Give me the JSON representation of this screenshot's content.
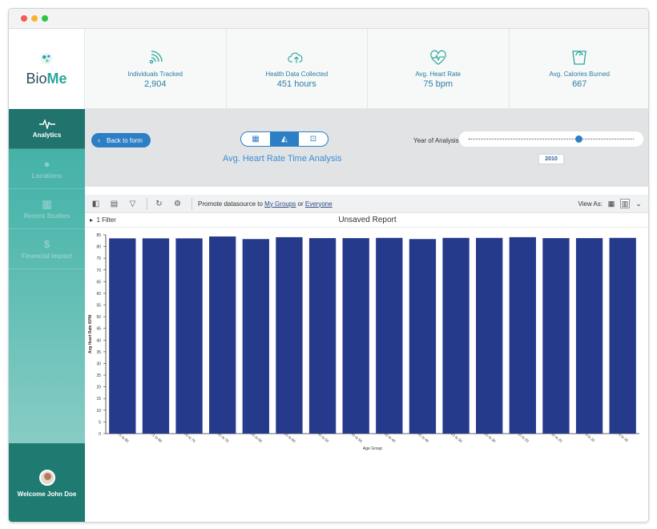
{
  "app": {
    "brand_plain": "Bio",
    "brand_bold": "Me"
  },
  "sidebar": {
    "items": [
      {
        "label": "Analytics",
        "icon": "pulse-icon",
        "active": true
      },
      {
        "label": "Locations",
        "icon": "pin-icon",
        "active": false
      },
      {
        "label": "Recent Studies",
        "icon": "book-icon",
        "active": false
      },
      {
        "label": "Financial Impact",
        "icon": "dollar-icon",
        "active": false
      }
    ],
    "user_greeting": "Welcome John Doe"
  },
  "stats": [
    {
      "label": "Individuals Tracked",
      "value": "2,904",
      "icon": "signal-icon"
    },
    {
      "label": "Health Data Collected",
      "value": "451 hours",
      "icon": "cloud-upload-icon"
    },
    {
      "label": "Avg. Heart Rate",
      "value": "75 bpm",
      "icon": "heart-pulse-icon"
    },
    {
      "label": "Avg. Calories Burned",
      "value": "667",
      "icon": "scale-icon"
    }
  ],
  "controls": {
    "back_label": "Back to form",
    "title": "Avg. Heart Rate Time Analysis",
    "year_label": "Year of Analysis",
    "year_value": "2010",
    "selected_view": "area-chart"
  },
  "toolbar": {
    "promote_prefix": "Promote datasource to",
    "promote_my_groups": "My Groups",
    "promote_or": "or",
    "promote_everyone": "Everyone",
    "view_as_label": "View As:"
  },
  "report": {
    "filter_label": "1 Filter",
    "title": "Unsaved Report"
  },
  "colors": {
    "accent": "#2c7ec5",
    "teal": "#2aa69a",
    "bar": "#253a8a"
  },
  "chart_data": {
    "type": "bar",
    "categories": [
      "71 to 80",
      "71 to 80",
      "61 to 70",
      "61 to 70",
      "51 to 60",
      "51 to 60",
      "41 to 50",
      "41 to 50",
      "31 to 40",
      "31 to 40",
      "21 to 30",
      "21 to 30",
      "11 to 20",
      "11 to 20",
      "0 to 10",
      "0 to 10"
    ],
    "values": [
      83.5,
      83.5,
      83.5,
      84.3,
      83.2,
      84,
      83.6,
      83.6,
      83.7,
      83.2,
      83.7,
      83.7,
      84,
      83.6,
      83.6,
      83.7
    ],
    "xlabel": "Age Group",
    "ylabel": "Avg Heart Rate BPM",
    "ylim": [
      0,
      85
    ],
    "yticks": [
      0,
      5,
      10,
      15,
      20,
      25,
      30,
      35,
      40,
      45,
      50,
      55,
      60,
      65,
      70,
      75,
      80,
      85
    ],
    "grid": false
  }
}
